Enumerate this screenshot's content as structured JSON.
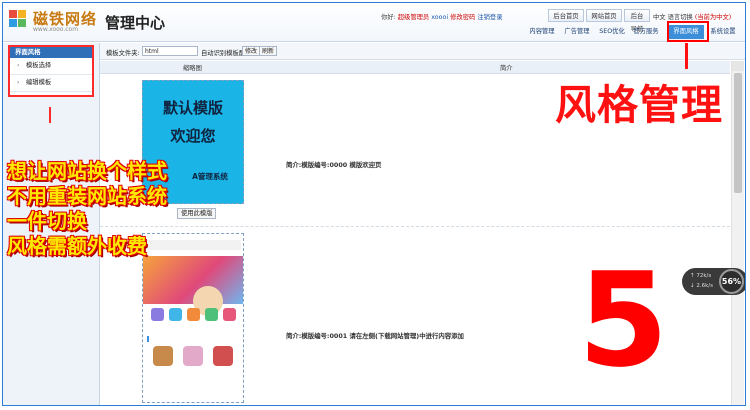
{
  "app": {
    "logo_text": "磁铁网络",
    "logo_url": "www.xooo.com",
    "system_title": "管理中心"
  },
  "topbar": {
    "greeting": "你好:",
    "role": "超级管理员",
    "username": "xoooi",
    "change_password": "修改密码",
    "logout": "注销登录",
    "buttons": [
      "后台首页",
      "网站首页",
      "后台导航"
    ],
    "lang_prefix": "中文",
    "lang_switch": "语言切换",
    "lang_current": "(当前为中文)"
  },
  "nav": {
    "tabs": [
      "内容管理",
      "广告管理",
      "SEO优化",
      "官方服务",
      "界面风格",
      "系统设置"
    ],
    "active_tab": "界面风格"
  },
  "sidebar": {
    "title": "界面风格",
    "items": [
      {
        "label": "模板选择"
      },
      {
        "label": "编辑模板"
      }
    ]
  },
  "toolbar": {
    "folder_label": "模板文件夹:",
    "folder_value": "html",
    "config_label": "自动识别模板配置",
    "btn_select": "修改",
    "btn_refresh": "刷新"
  },
  "table": {
    "col_thumb": "缩略图",
    "col_desc": "简介",
    "rows": [
      {
        "thumb_lines": [
          "默认模版",
          "欢迎您",
          "A管理系统"
        ],
        "use_button": "使用此模版",
        "description": "简介:模版编号:0000 模版欢迎页"
      },
      {
        "description": "简介:模版编号:0001 请在左侧(下载网站管理)中进行内容添加"
      }
    ]
  },
  "annotations": {
    "style_manage": "风格管理",
    "promo_lines": [
      "想让网站换个样式",
      "不用重装网站系统",
      "一件切换",
      "风格需额外收费"
    ],
    "big_number": "5"
  },
  "speed_widget": {
    "up": "72k/s",
    "down": "2.6k/s",
    "percent": "56%"
  },
  "colors": {
    "accent": "#2f6fb7",
    "active_tab": "#3d8ed8",
    "annotation_red": "#ff1111",
    "promo_yellow": "#ffe800"
  }
}
